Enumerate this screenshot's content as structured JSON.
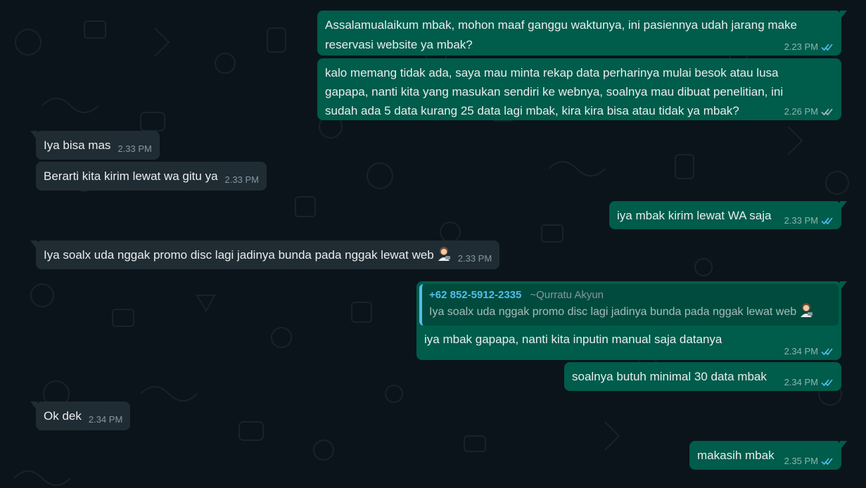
{
  "theme": {
    "background": "#0b141a",
    "outgoing_bubble": "#005c4b",
    "incoming_bubble": "#202c33",
    "read_tick": "#53bdeb",
    "quote_accent": "#53bdeb"
  },
  "messages": [
    {
      "id": "m1",
      "direction": "outgoing",
      "text": "Assalamualaikum mbak, mohon maaf ganggu waktunya, ini pasiennya udah jarang make\nreservasi website ya mbak?",
      "time": "2.23 PM",
      "status": "read"
    },
    {
      "id": "m2",
      "direction": "outgoing",
      "text": "kalo memang tidak ada, saya mau minta rekap data perharinya mulai besok atau lusa\ngapapa, nanti kita yang masukan sendiri ke webnya, soalnya mau dibuat penelitian, ini\nsudah ada 5 data kurang 25 data lagi mbak, kira kira bisa atau tidak ya mbak?",
      "time": "2.26 PM",
      "status": "delivered"
    },
    {
      "id": "m3",
      "direction": "incoming",
      "text": "Iya bisa mas",
      "time": "2.33 PM"
    },
    {
      "id": "m4",
      "direction": "incoming",
      "text": "Berarti kita kirim lewat wa gitu ya",
      "time": "2.33 PM"
    },
    {
      "id": "m5",
      "direction": "outgoing",
      "text": "iya mbak kirim lewat WA saja",
      "time": "2.33 PM",
      "status": "read"
    },
    {
      "id": "m6",
      "direction": "incoming",
      "text": "Iya soalx uda nggak promo disc lagi jadinya bunda pada nggak lewat web",
      "emoji": "woman-technologist-emoji",
      "time": "2.33 PM"
    },
    {
      "id": "m7",
      "direction": "outgoing",
      "quote": {
        "phone": "+62 852-5912-2335",
        "name": "~Qurratu Akyun",
        "text": "Iya soalx uda nggak promo disc lagi jadinya bunda pada nggak lewat web",
        "emoji": "woman-technologist-emoji"
      },
      "text": "iya mbak gapapa, nanti kita inputin manual saja datanya",
      "time": "2.34 PM",
      "status": "read"
    },
    {
      "id": "m8",
      "direction": "outgoing",
      "text": "soalnya butuh minimal 30 data mbak",
      "time": "2.34 PM",
      "status": "read"
    },
    {
      "id": "m9",
      "direction": "incoming",
      "text": "Ok dek",
      "time": "2.34 PM"
    },
    {
      "id": "m10",
      "direction": "outgoing",
      "text": "makasih mbak",
      "time": "2.35 PM",
      "status": "read"
    }
  ]
}
